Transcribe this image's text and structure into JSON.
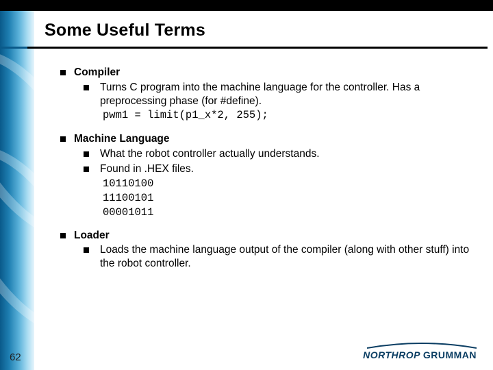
{
  "slide": {
    "title": "Some Useful Terms",
    "page_number": "62",
    "brand": {
      "name_part1": "NORTHROP ",
      "name_part2": "GRUMMAN"
    }
  },
  "bullets": [
    {
      "term": "Compiler",
      "subs": [
        {
          "text": "Turns C program into the machine language for the controller. Has a preprocessing phase (for #define)."
        }
      ],
      "code": [
        "pwm1 = limit(p1_x*2, 255);"
      ]
    },
    {
      "term": "Machine Language",
      "subs": [
        {
          "text": "What the robot controller actually understands."
        },
        {
          "text": "Found in .HEX files."
        }
      ],
      "code": [
        "10110100",
        "11100101",
        "00001011"
      ]
    },
    {
      "term": "Loader",
      "subs": [
        {
          "text": "Loads the machine language output of the compiler (along with other stuff) into the robot controller."
        }
      ],
      "code": []
    }
  ]
}
